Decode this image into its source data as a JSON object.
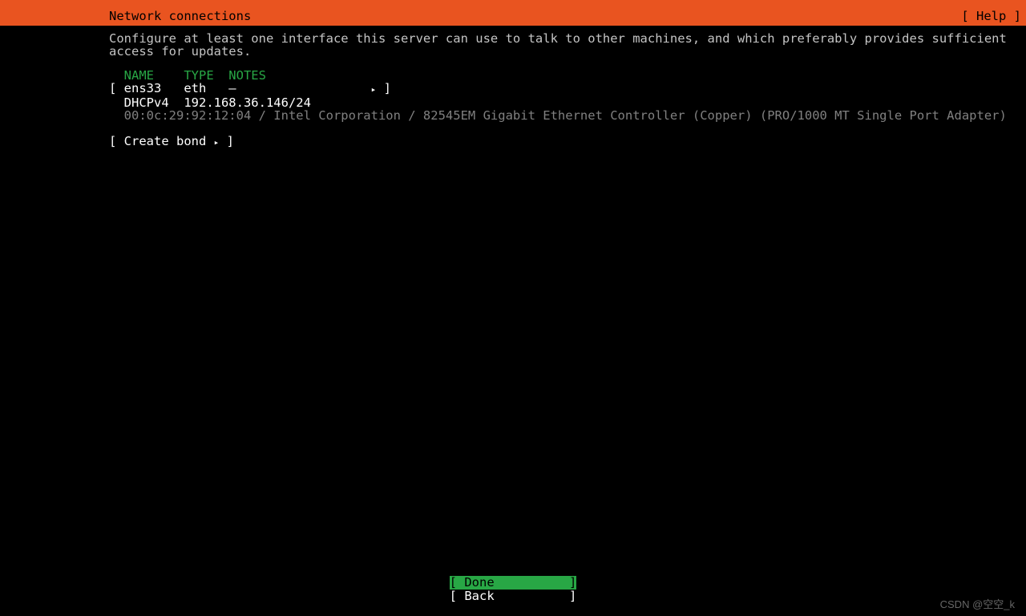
{
  "header": {
    "title": "Network connections",
    "help": "[ Help ]"
  },
  "instruction_line1": "Configure at least one interface this server can use to talk to other machines, and which preferably provides sufficient",
  "instruction_line2": "access for updates.",
  "table": {
    "header": "  NAME    TYPE  NOTES",
    "row_prefix": "[ ens33   eth   –                  ",
    "row_suffix": " ]",
    "dhcp_line": "  DHCPv4  192.168.36.146/24",
    "hw_line": "  00:0c:29:92:12:04 / Intel Corporation / 82545EM Gigabit Ethernet Controller (Copper) (PRO/1000 MT Single Port Adapter)"
  },
  "create_bond": {
    "prefix": "[ Create bond ",
    "suffix": " ]"
  },
  "footer": {
    "done": "[ Done          ]",
    "back": "[ Back          ]"
  },
  "watermark": "CSDN @空空_k",
  "arrow": "▸"
}
